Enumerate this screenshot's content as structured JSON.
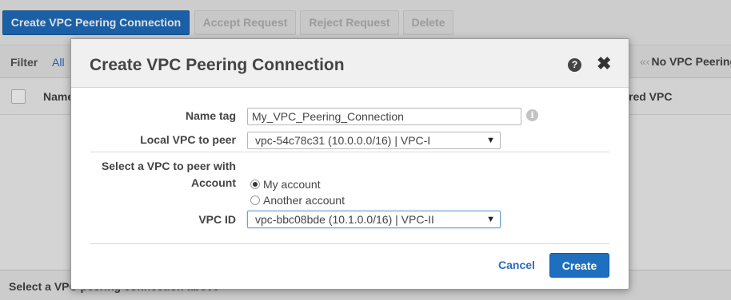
{
  "toolbar": {
    "create_label": "Create VPC Peering Connection",
    "accept_label": "Accept Request",
    "reject_label": "Reject Request",
    "delete_label": "Delete"
  },
  "filter_bar": {
    "filter_label": "Filter",
    "filter_value": "All",
    "pager_text": "No VPC Peering"
  },
  "grid": {
    "columns": [
      "Name",
      "red VPC"
    ]
  },
  "detail_pane": {
    "placeholder": "Select a VPC peering connection above"
  },
  "modal": {
    "title": "Create VPC Peering Connection",
    "name_tag_label": "Name tag",
    "name_tag_value": "My_VPC_Peering_Connection",
    "local_vpc_label": "Local VPC to peer",
    "local_vpc_value": "vpc-54c78c31 (10.0.0.0/16) | VPC-I",
    "peer_section_label_line1": "Select a VPC to peer with",
    "account_label": "Account",
    "account_options": [
      "My account",
      "Another account"
    ],
    "account_selected": "My account",
    "vpc_id_label": "VPC ID",
    "vpc_id_value": "vpc-bbc08bde (10.1.0.0/16) | VPC-II",
    "cancel_label": "Cancel",
    "create_label": "Create"
  },
  "colors": {
    "primary_button": "#1f6fbf",
    "link": "#2a6cc2"
  }
}
